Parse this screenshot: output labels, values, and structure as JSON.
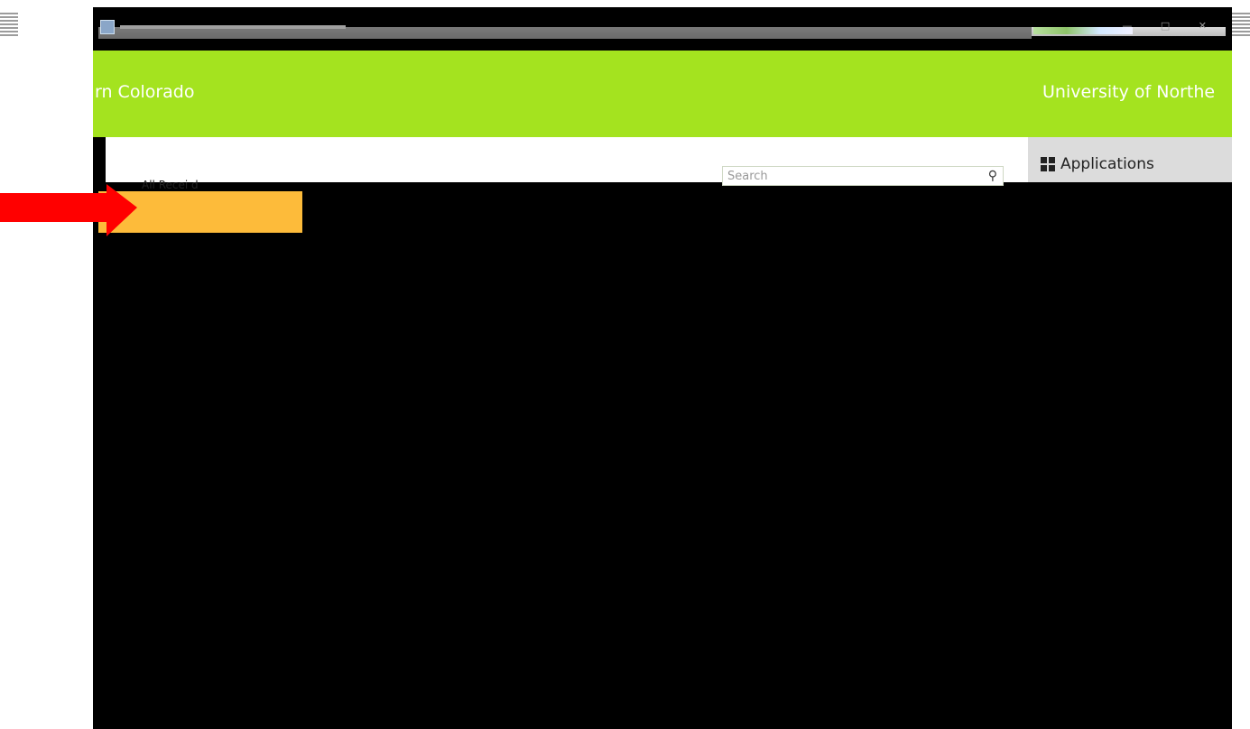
{
  "titlebar": {
    "controls": "—  □  ✕"
  },
  "header": {
    "band_left_text": "rn Colorado",
    "band_right_text": "University of Northe"
  },
  "content": {
    "search_placeholder": "Search",
    "partial_heading": "All     Recei  d"
  },
  "sidebar": {
    "applications_label": "Applications"
  },
  "icons": {
    "search": "search-icon",
    "applications": "grid-icon",
    "annotation": "arrow-icon"
  },
  "colors": {
    "band_green": "#a4e31f",
    "highlight_orange": "#fdbb3a",
    "arrow_red": "#ff0000",
    "sidebar_gray": "#dcdcdc"
  }
}
